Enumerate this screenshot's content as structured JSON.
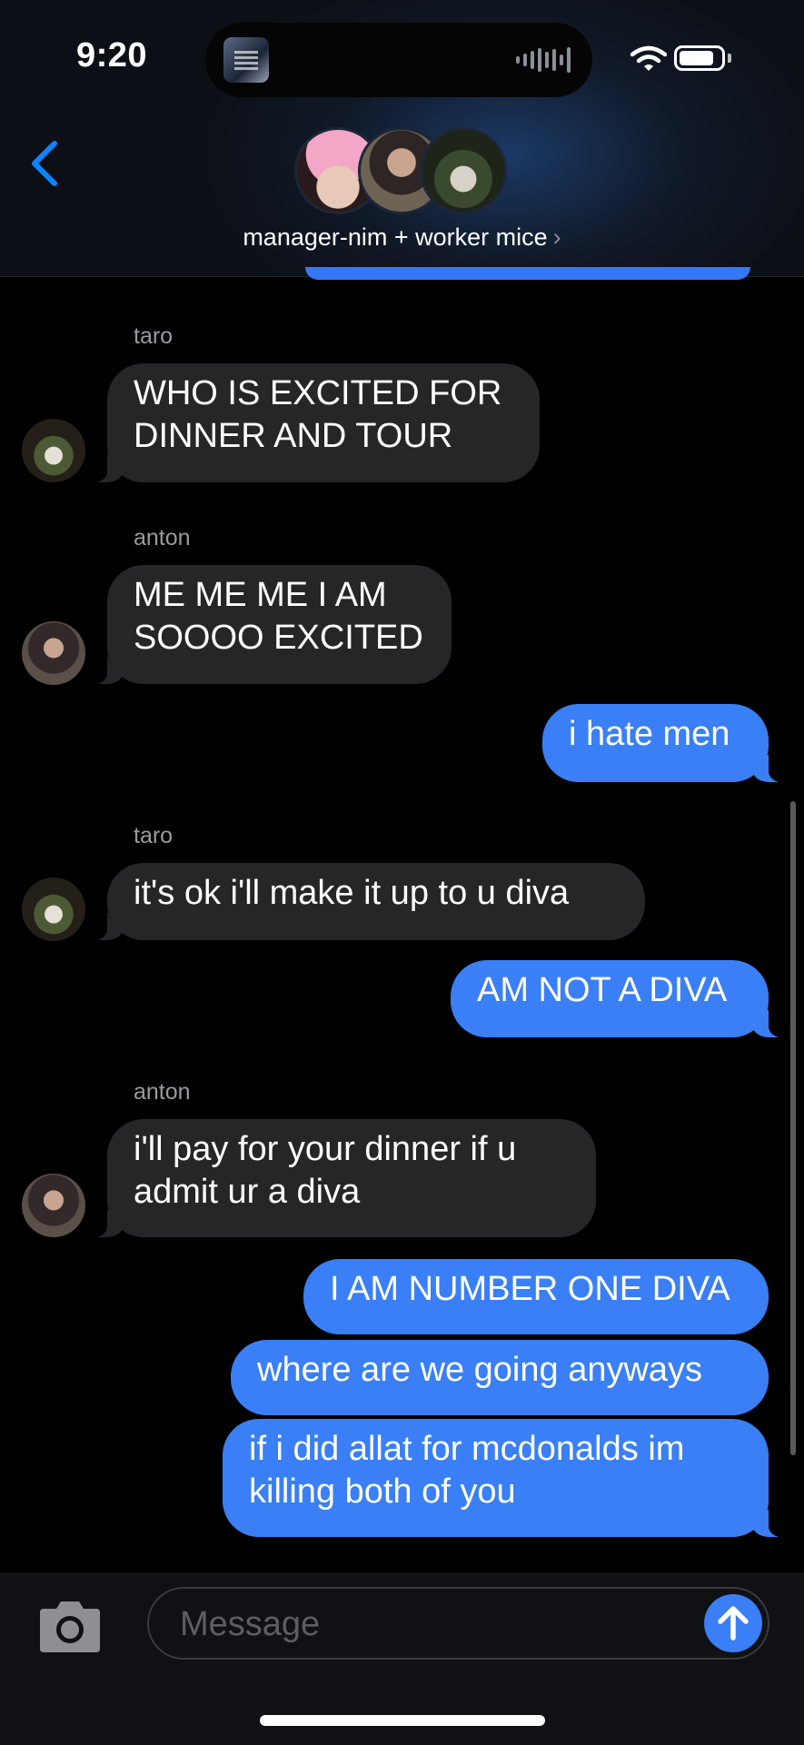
{
  "status": {
    "time": "9:20",
    "battery_level": 0.85
  },
  "header": {
    "title": "manager-nim + worker mice",
    "title_chevron": "›"
  },
  "messages": [
    {
      "sender": "taro",
      "text_lines": [
        "WHO IS EXCITED FOR",
        "DINNER AND TOUR"
      ]
    },
    {
      "sender": "anton",
      "text_lines": [
        "ME ME ME I AM",
        "SOOOO EXCITED"
      ]
    },
    {
      "sender": "me",
      "text_lines": [
        "i hate men"
      ]
    },
    {
      "sender": "taro",
      "text_lines": [
        "it's ok i'll make it up to u diva"
      ]
    },
    {
      "sender": "me",
      "text_lines": [
        "AM NOT A DIVA"
      ]
    },
    {
      "sender": "anton",
      "text_lines": [
        "i'll pay for your dinner if u",
        "admit ur a diva"
      ]
    },
    {
      "sender": "me",
      "text_lines": [
        "I AM NUMBER ONE DIVA"
      ]
    },
    {
      "sender": "me",
      "text_lines": [
        "where are we going anyways"
      ]
    },
    {
      "sender": "me",
      "text_lines": [
        "if i did allat for mcdonalds im",
        "killing both of you"
      ]
    }
  ],
  "input": {
    "placeholder": "Message"
  },
  "icons": {
    "back": "chevron-left-icon",
    "camera": "camera-icon",
    "send": "arrow-up-icon",
    "wifi": "wifi-icon",
    "battery": "battery-icon",
    "audio_wave": "waveform-icon"
  },
  "colors": {
    "outgoing_bubble": "#3a7ff5",
    "incoming_bubble": "#262629",
    "accent": "#0a84ff"
  }
}
